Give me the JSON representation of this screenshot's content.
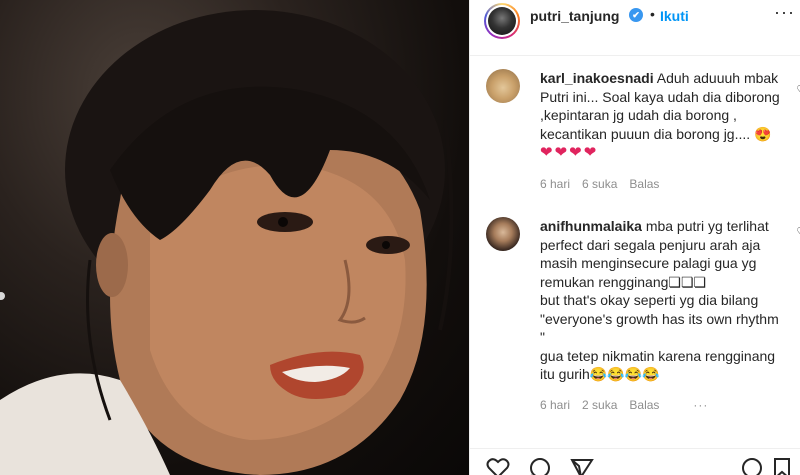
{
  "header": {
    "username": "putri_tanjung",
    "verified_mark": "✔",
    "separator": "•",
    "follow_label": "Ikuti",
    "more": "···"
  },
  "comments": [
    {
      "username": "karl_inakoesnadi",
      "text": "Aduh aduuuh mbak Putri ini... Soal kaya udah dia diborong ,kepintaran jg udah dia borong , kecantikan puuun dia borong jg....",
      "emojis": [
        "😍",
        "❤",
        "❤",
        "❤",
        "❤"
      ],
      "time": "6 hari",
      "likes": "6 suka",
      "reply": "Balas"
    },
    {
      "username": "anifhunmalaika",
      "text_line1": "mba putri yg terlihat perfect dari segala penjuru arah aja masih menginsecure palagi gua yg remukan rengginang",
      "text_line1_suffix": "❏❏❏",
      "text_line2": "but that's okay seperti yg dia bilang \"everyone's growth has its own rhythm \"",
      "text_line3": "gua tetep nikmatin karena rengginang itu gurih",
      "emojis": [
        "😂",
        "😂",
        "😂",
        "😂"
      ],
      "time": "6 hari",
      "likes": "2 suka",
      "reply": "Balas",
      "more": "···"
    }
  ],
  "icons": {
    "header_avatar": "avatar",
    "heart_small": "heart-outline-icon",
    "footer": [
      "heart-outline-icon",
      "comment-icon",
      "share-icon",
      "bookmark-icon"
    ]
  }
}
